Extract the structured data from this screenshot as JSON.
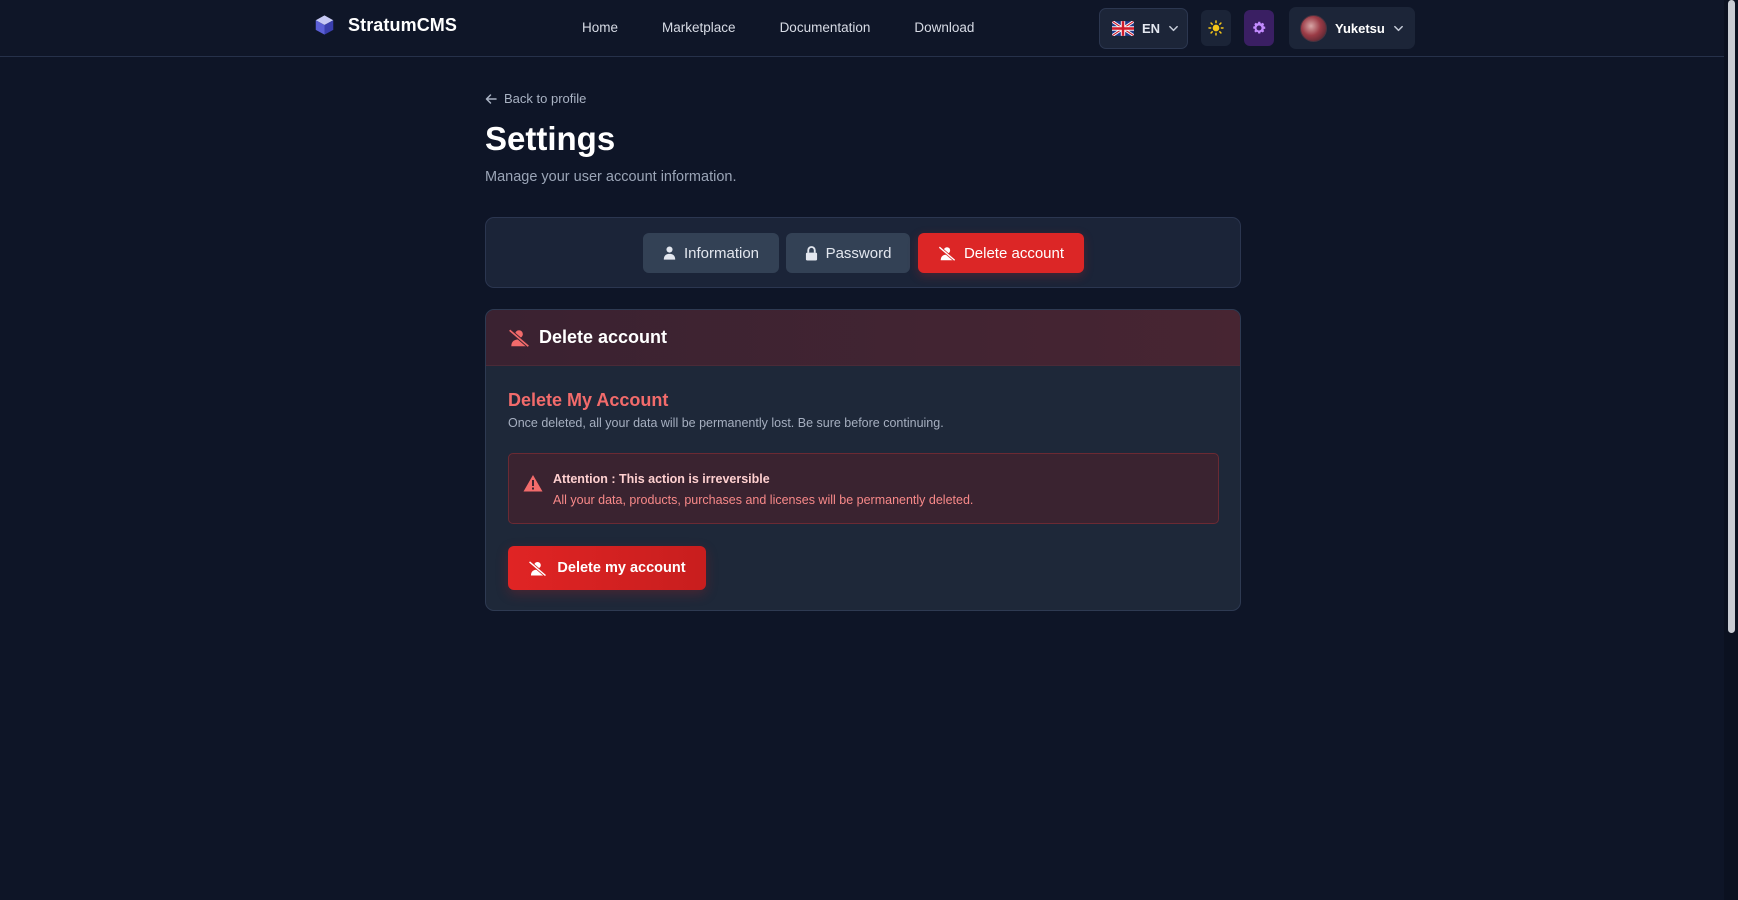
{
  "brand": {
    "name": "StratumCMS"
  },
  "nav": {
    "links": [
      "Home",
      "Marketplace",
      "Documentation",
      "Download"
    ]
  },
  "language": {
    "code": "EN",
    "flag": "uk-flag-icon"
  },
  "user": {
    "name": "Yuketsu"
  },
  "page": {
    "back_label": "Back to profile",
    "title": "Settings",
    "subtitle": "Manage your user account information."
  },
  "tabs": [
    {
      "label": "Information",
      "icon": "user-icon",
      "active": false
    },
    {
      "label": "Password",
      "icon": "lock-icon",
      "active": false
    },
    {
      "label": "Delete account",
      "icon": "user-slash-icon",
      "active": true
    }
  ],
  "danger_card": {
    "header_title": "Delete account",
    "section_title": "Delete My Account",
    "section_desc": "Once deleted, all your data will be permanently lost. Be sure before continuing.",
    "alert_title": "Attention : This action is irreversible",
    "alert_text": "All your data, products, purchases and licenses will be permanently deleted.",
    "delete_button_label": "Delete my account"
  },
  "colors": {
    "background": "#0e1527",
    "danger": "#dc2626",
    "danger_text": "#f26b6b",
    "tab_inactive": "#334155",
    "accent_purple": "#3a1f63"
  }
}
